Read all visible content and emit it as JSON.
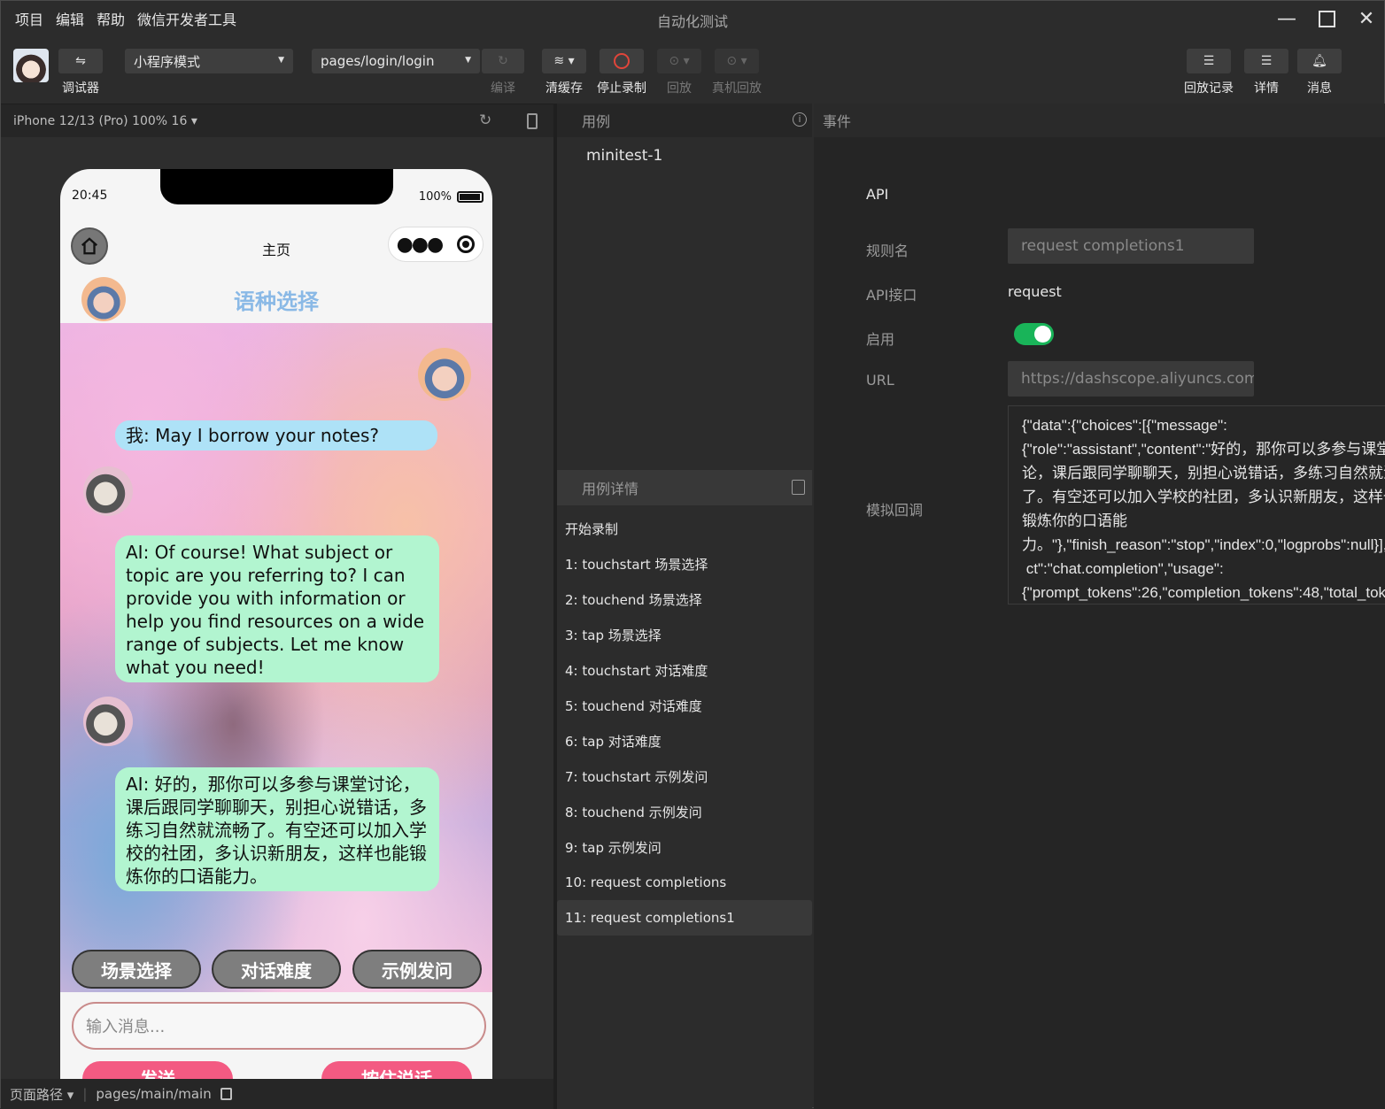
{
  "menubar": {
    "items": [
      "项目",
      "编辑",
      "帮助",
      "微信开发者工具"
    ],
    "title": "自动化测试"
  },
  "toolbar": {
    "debugger_label": "调试器",
    "mode_select": "小程序模式",
    "page_select": "pages/login/login",
    "compile_label": "编译",
    "clear_cache_label": "清缓存",
    "stop_record_label": "停止录制",
    "replay_label": "回放",
    "device_replay_label": "真机回放",
    "replay_log_label": "回放记录",
    "details_label": "详情",
    "messages_label": "消息"
  },
  "simulator": {
    "device_label": "iPhone 12/13 (Pro) 100% 16 ▾",
    "time": "20:45",
    "battery": "100%",
    "nav_title": "主页",
    "header_title": "语种选择",
    "messages": [
      {
        "role": "user",
        "text": "我: May I borrow your notes?"
      },
      {
        "role": "ai",
        "text": "AI: Of course! What subject or topic are you referring to? I can provide you with information or help you find resources on a wide range of subjects. Let me know what you need!"
      },
      {
        "role": "ai",
        "text": "AI: 好的，那你可以多参与课堂讨论，课后跟同学聊聊天，别担心说错话，多练习自然就流畅了。有空还可以加入学校的社团，多认识新朋友，这样也能锻炼你的口语能力。"
      }
    ],
    "actions": [
      "场景选择",
      "对话难度",
      "示例发问"
    ],
    "input_placeholder": "输入消息...",
    "send_label": "发送",
    "hold_label": "按住说话",
    "path_label": "页面路径 ▾",
    "path_value": "pages/main/main"
  },
  "cases_panel": {
    "header": "用例",
    "items": [
      "minitest-1"
    ],
    "detail_header": "用例详情",
    "details": [
      "开始录制",
      "1: touchstart 场景选择",
      "2: touchend 场景选择",
      "3: tap 场景选择",
      "4: touchstart 对话难度",
      "5: touchend 对话难度",
      "6: tap 对话难度",
      "7: touchstart 示例发问",
      "8: touchend 示例发问",
      "9: tap 示例发问",
      "10: request completions",
      "11: request completions1"
    ],
    "selected_index": 11
  },
  "events_panel": {
    "header": "事件",
    "section": "API",
    "rule_label": "规则名",
    "rule_value": "request completions1",
    "api_label": "API接口",
    "api_value": "request",
    "enable_label": "启用",
    "enabled": true,
    "url_label": "URL",
    "url_value": "https://dashscope.aliyuncs.com/",
    "mock_label": "模拟回调",
    "mock_value": "{\"data\":{\"choices\":[{\"message\":\n{\"role\":\"assistant\",\"content\":\"好的，那你可以多参与课堂讨\n论，课后跟同学聊聊天，别担心说错话，多练习自然就流畅\n了。有空还可以加入学校的社团，多认识新朋友，这样也能\n锻炼你的口语能\n力。\"},\"finish_reason\":\"stop\",\"index\":0,\"logprobs\":null}],\"object\n ct\":\"chat.completion\",\"usage\":\n{\"prompt_tokens\":26,\"completion_tokens\":48,\"total_tokens\""
  },
  "colors": {
    "toggle_on": "#19b459",
    "user_bubble": "#aee2f7",
    "ai_bubble": "#b2f5d0",
    "header_title": "#8ab9e6",
    "pink_button": "#f35a82"
  }
}
